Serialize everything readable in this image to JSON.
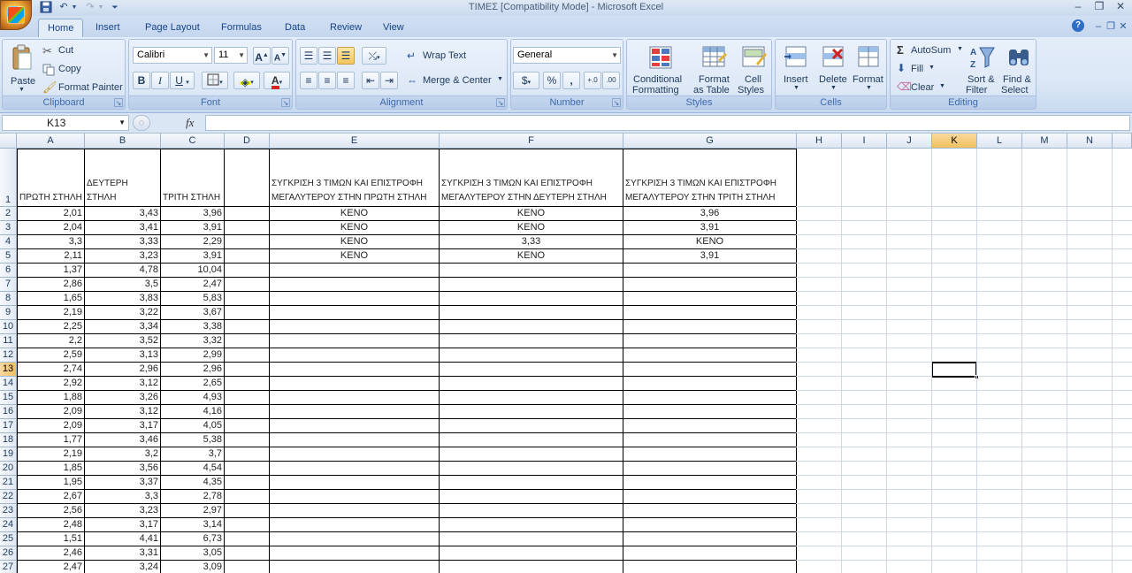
{
  "window": {
    "title": "ΤΙΜΕΣ  [Compatibility Mode] - Microsoft Excel"
  },
  "tabs": [
    "Home",
    "Insert",
    "Page Layout",
    "Formulas",
    "Data",
    "Review",
    "View"
  ],
  "ribbon": {
    "clipboard": {
      "label": "Clipboard",
      "paste": "Paste",
      "cut": "Cut",
      "copy": "Copy",
      "format_painter": "Format Painter"
    },
    "font": {
      "label": "Font",
      "font_name": "Calibri",
      "font_size": "11"
    },
    "alignment": {
      "label": "Alignment",
      "wrap_text": "Wrap Text",
      "merge_center": "Merge & Center"
    },
    "number": {
      "label": "Number",
      "format": "General"
    },
    "styles": {
      "label": "Styles",
      "conditional_formatting_1": "Conditional",
      "conditional_formatting_2": "Formatting",
      "format_table_1": "Format",
      "format_table_2": "as Table",
      "cell_styles_1": "Cell",
      "cell_styles_2": "Styles"
    },
    "cells": {
      "label": "Cells",
      "insert": "Insert",
      "delete": "Delete",
      "format": "Format"
    },
    "editing": {
      "label": "Editing",
      "autosum": "AutoSum",
      "fill": "Fill",
      "clear": "Clear",
      "sort_filter_1": "Sort &",
      "sort_filter_2": "Filter",
      "find_select_1": "Find &",
      "find_select_2": "Select"
    }
  },
  "formula_bar": {
    "name_box": "K13",
    "fx": "fx",
    "formula": ""
  },
  "columns": [
    "A",
    "B",
    "C",
    "D",
    "E",
    "F",
    "G",
    "H",
    "I",
    "J",
    "K",
    "L",
    "M",
    "N"
  ],
  "selected_column": "K",
  "selected_row": "13",
  "headers": {
    "A": "ΠΡΩΤΗ ΣΤΗΛΗ",
    "B": "ΔΕΥΤΕΡΗ ΣΤΗΛΗ",
    "C": "ΤΡΙΤΗ ΣΤΗΛΗ",
    "E": "ΣΥΓΚΡΙΣΗ 3 ΤΙΜΩΝ ΚΑΙ ΕΠΙΣΤΡΟΦΗ ΜΕΓΑΛΥΤΕΡΟΥ ΣΤΗΝ ΠΡΩΤΗ ΣΤΗΛΗ",
    "F": "ΣΥΓΚΡΙΣΗ 3 ΤΙΜΩΝ ΚΑΙ ΕΠΙΣΤΡΟΦΗ ΜΕΓΑΛΥΤΕΡΟΥ ΣΤΗΝ ΔΕΥΤΕΡΗ ΣΤΗΛΗ",
    "G": "ΣΥΓΚΡΙΣΗ 3 ΤΙΜΩΝ ΚΑΙ ΕΠΙΣΤΡΟΦΗ ΜΕΓΑΛΥΤΕΡΟΥ ΣΤΗΝ ΤΡΙΤΗ ΣΤΗΛΗ"
  },
  "rows": [
    {
      "n": "2",
      "A": "2,01",
      "B": "3,43",
      "C": "3,96",
      "E": "ΚΕΝΟ",
      "F": "ΚΕΝΟ",
      "G": "3,96"
    },
    {
      "n": "3",
      "A": "2,04",
      "B": "3,41",
      "C": "3,91",
      "E": "ΚΕΝΟ",
      "F": "ΚΕΝΟ",
      "G": "3,91"
    },
    {
      "n": "4",
      "A": "3,3",
      "B": "3,33",
      "C": "2,29",
      "E": "ΚΕΝΟ",
      "F": "3,33",
      "G": "ΚΕΝΟ"
    },
    {
      "n": "5",
      "A": "2,11",
      "B": "3,23",
      "C": "3,91",
      "E": "ΚΕΝΟ",
      "F": "ΚΕΝΟ",
      "G": "3,91"
    },
    {
      "n": "6",
      "A": "1,37",
      "B": "4,78",
      "C": "10,04",
      "E": "",
      "F": "",
      "G": ""
    },
    {
      "n": "7",
      "A": "2,86",
      "B": "3,5",
      "C": "2,47",
      "E": "",
      "F": "",
      "G": ""
    },
    {
      "n": "8",
      "A": "1,65",
      "B": "3,83",
      "C": "5,83",
      "E": "",
      "F": "",
      "G": ""
    },
    {
      "n": "9",
      "A": "2,19",
      "B": "3,22",
      "C": "3,67",
      "E": "",
      "F": "",
      "G": ""
    },
    {
      "n": "10",
      "A": "2,25",
      "B": "3,34",
      "C": "3,38",
      "E": "",
      "F": "",
      "G": ""
    },
    {
      "n": "11",
      "A": "2,2",
      "B": "3,52",
      "C": "3,32",
      "E": "",
      "F": "",
      "G": ""
    },
    {
      "n": "12",
      "A": "2,59",
      "B": "3,13",
      "C": "2,99",
      "E": "",
      "F": "",
      "G": ""
    },
    {
      "n": "13",
      "A": "2,74",
      "B": "2,96",
      "C": "2,96",
      "E": "",
      "F": "",
      "G": ""
    },
    {
      "n": "14",
      "A": "2,92",
      "B": "3,12",
      "C": "2,65",
      "E": "",
      "F": "",
      "G": ""
    },
    {
      "n": "15",
      "A": "1,88",
      "B": "3,26",
      "C": "4,93",
      "E": "",
      "F": "",
      "G": ""
    },
    {
      "n": "16",
      "A": "2,09",
      "B": "3,12",
      "C": "4,16",
      "E": "",
      "F": "",
      "G": ""
    },
    {
      "n": "17",
      "A": "2,09",
      "B": "3,17",
      "C": "4,05",
      "E": "",
      "F": "",
      "G": ""
    },
    {
      "n": "18",
      "A": "1,77",
      "B": "3,46",
      "C": "5,38",
      "E": "",
      "F": "",
      "G": ""
    },
    {
      "n": "19",
      "A": "2,19",
      "B": "3,2",
      "C": "3,7",
      "E": "",
      "F": "",
      "G": ""
    },
    {
      "n": "20",
      "A": "1,85",
      "B": "3,56",
      "C": "4,54",
      "E": "",
      "F": "",
      "G": ""
    },
    {
      "n": "21",
      "A": "1,95",
      "B": "3,37",
      "C": "4,35",
      "E": "",
      "F": "",
      "G": ""
    },
    {
      "n": "22",
      "A": "2,67",
      "B": "3,3",
      "C": "2,78",
      "E": "",
      "F": "",
      "G": ""
    },
    {
      "n": "23",
      "A": "2,56",
      "B": "3,23",
      "C": "2,97",
      "E": "",
      "F": "",
      "G": ""
    },
    {
      "n": "24",
      "A": "2,48",
      "B": "3,17",
      "C": "3,14",
      "E": "",
      "F": "",
      "G": ""
    },
    {
      "n": "25",
      "A": "1,51",
      "B": "4,41",
      "C": "6,73",
      "E": "",
      "F": "",
      "G": ""
    },
    {
      "n": "26",
      "A": "2,46",
      "B": "3,31",
      "C": "3,05",
      "E": "",
      "F": "",
      "G": ""
    },
    {
      "n": "27",
      "A": "2,47",
      "B": "3,24",
      "C": "3,09",
      "E": "",
      "F": "",
      "G": ""
    }
  ]
}
